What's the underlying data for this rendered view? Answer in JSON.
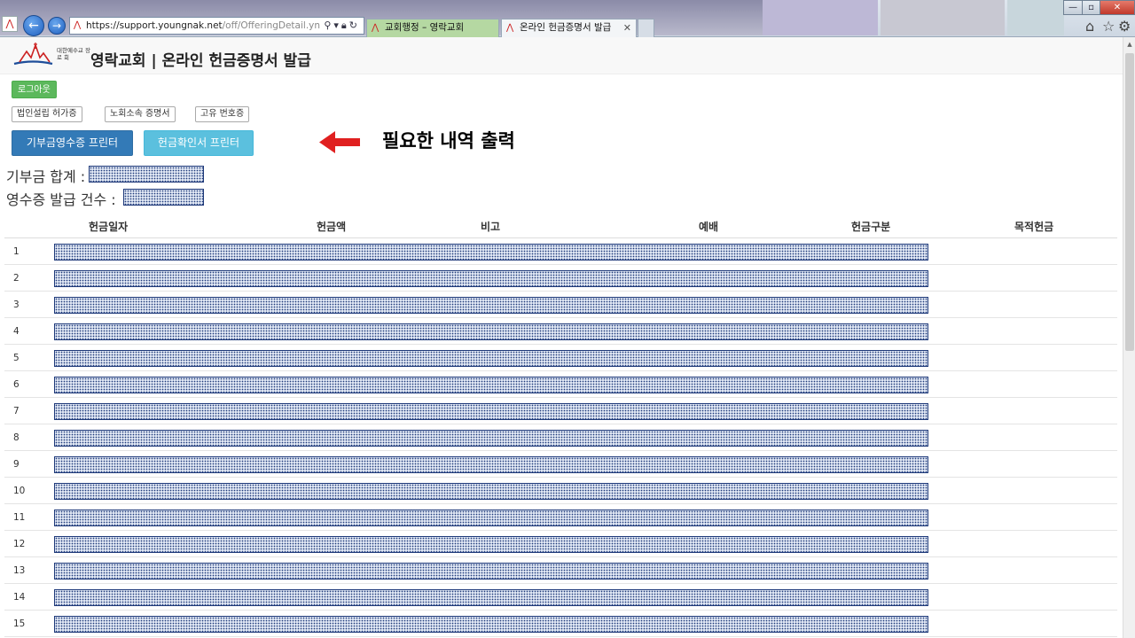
{
  "browser": {
    "url_host": "https://support.youngnak.net",
    "url_path": "/off/OfferingDetail.yn",
    "tabs": [
      {
        "label": "교회행정 – 영락교회"
      },
      {
        "label": "온라인 헌금증명서 발급"
      }
    ]
  },
  "header": {
    "logo_sub": "대한예수교 장 로 회",
    "title": "영락교회 | 온라인 헌금증명서 발급"
  },
  "buttons": {
    "logout": "로그아웃",
    "docs": [
      "법인설립 허가증",
      "노회소속 증명서",
      "고유 번호증"
    ],
    "print_receipt": "기부금영수증 프린터",
    "print_confirm": "헌금확인서 프린터"
  },
  "annotation": "필요한 내역 출력",
  "summary": {
    "total_label": "기부금 합계 :",
    "count_label": "영수증 발급 건수 :"
  },
  "table": {
    "columns": [
      "헌금일자",
      "헌금액",
      "비고",
      "예배",
      "헌금구분",
      "목적헌금"
    ],
    "rows": [
      "1",
      "2",
      "3",
      "4",
      "5",
      "6",
      "7",
      "8",
      "9",
      "10",
      "11",
      "12",
      "13",
      "14",
      "15"
    ]
  },
  "colors": {
    "logout_green": "#5cb85c",
    "primary_blue": "#337ab7",
    "info_blue": "#5bc0de",
    "arrow_red": "#e02020",
    "mask_navy": "#1f3a7a"
  }
}
